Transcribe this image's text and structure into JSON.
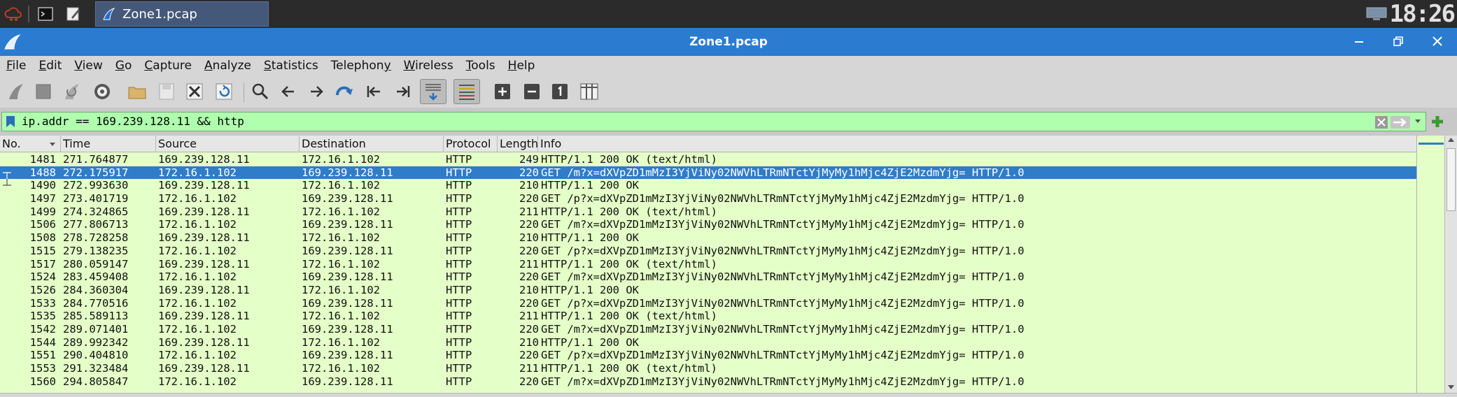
{
  "taskbar": {
    "window_title": "Zone1.pcap",
    "clock": "18:26"
  },
  "window": {
    "title": "Zone1.pcap",
    "controls": [
      "minimize-icon",
      "restore-icon",
      "close-icon"
    ]
  },
  "menu": [
    {
      "label": "File",
      "accel": "F"
    },
    {
      "label": "Edit",
      "accel": "E"
    },
    {
      "label": "View",
      "accel": "V"
    },
    {
      "label": "Go",
      "accel": "G"
    },
    {
      "label": "Capture",
      "accel": "C"
    },
    {
      "label": "Analyze",
      "accel": "A"
    },
    {
      "label": "Statistics",
      "accel": "S"
    },
    {
      "label": "Telephony",
      "accel": "y"
    },
    {
      "label": "Wireless",
      "accel": "W"
    },
    {
      "label": "Tools",
      "accel": "T"
    },
    {
      "label": "Help",
      "accel": "H"
    }
  ],
  "toolbar_icons": [
    "start-capture-icon",
    "stop-capture-icon",
    "restart-capture-icon",
    "capture-options-icon",
    "open-file-icon",
    "save-file-icon",
    "close-file-icon",
    "reload-file-icon",
    "find-packet-icon",
    "go-back-icon",
    "go-forward-icon",
    "go-to-packet-icon",
    "first-packet-icon",
    "last-packet-icon",
    "autoscroll-icon",
    "colorize-icon",
    "zoom-in-icon",
    "zoom-out-icon",
    "normal-size-icon",
    "resize-columns-icon"
  ],
  "filter": {
    "value": "ip.addr == 169.239.128.11 && http",
    "accent": "#afffaf"
  },
  "columns": {
    "no": "No.",
    "time": "Time",
    "source": "Source",
    "destination": "Destination",
    "protocol": "Protocol",
    "length": "Length",
    "info": "Info"
  },
  "colors": {
    "row_bg": "#e4ffc7",
    "selected_bg": "#2f7cc8",
    "titlebar": "#2b7bd1"
  },
  "rows": [
    {
      "no": "1481",
      "time": "271.764877",
      "src": "169.239.128.11",
      "dst": "172.16.1.102",
      "proto": "HTTP",
      "len": "249",
      "info": "HTTP/1.1 200 OK  (text/html)"
    },
    {
      "no": "1488",
      "time": "272.175917",
      "src": "172.16.1.102",
      "dst": "169.239.128.11",
      "proto": "HTTP",
      "len": "220",
      "info": "GET /m?x=dXVpZD1mMzI3YjViNy02NWVhLTRmNTctYjMyMy1hMjc4ZjE2MzdmYjg= HTTP/1.0",
      "selected": true
    },
    {
      "no": "1490",
      "time": "272.993630",
      "src": "169.239.128.11",
      "dst": "172.16.1.102",
      "proto": "HTTP",
      "len": "210",
      "info": "HTTP/1.1 200 OK"
    },
    {
      "no": "1497",
      "time": "273.401719",
      "src": "172.16.1.102",
      "dst": "169.239.128.11",
      "proto": "HTTP",
      "len": "220",
      "info": "GET /p?x=dXVpZD1mMzI3YjViNy02NWVhLTRmNTctYjMyMy1hMjc4ZjE2MzdmYjg= HTTP/1.0"
    },
    {
      "no": "1499",
      "time": "274.324865",
      "src": "169.239.128.11",
      "dst": "172.16.1.102",
      "proto": "HTTP",
      "len": "211",
      "info": "HTTP/1.1 200 OK  (text/html)"
    },
    {
      "no": "1506",
      "time": "277.806713",
      "src": "172.16.1.102",
      "dst": "169.239.128.11",
      "proto": "HTTP",
      "len": "220",
      "info": "GET /m?x=dXVpZD1mMzI3YjViNy02NWVhLTRmNTctYjMyMy1hMjc4ZjE2MzdmYjg= HTTP/1.0"
    },
    {
      "no": "1508",
      "time": "278.728258",
      "src": "169.239.128.11",
      "dst": "172.16.1.102",
      "proto": "HTTP",
      "len": "210",
      "info": "HTTP/1.1 200 OK"
    },
    {
      "no": "1515",
      "time": "279.138235",
      "src": "172.16.1.102",
      "dst": "169.239.128.11",
      "proto": "HTTP",
      "len": "220",
      "info": "GET /p?x=dXVpZD1mMzI3YjViNy02NWVhLTRmNTctYjMyMy1hMjc4ZjE2MzdmYjg= HTTP/1.0"
    },
    {
      "no": "1517",
      "time": "280.059147",
      "src": "169.239.128.11",
      "dst": "172.16.1.102",
      "proto": "HTTP",
      "len": "211",
      "info": "HTTP/1.1 200 OK  (text/html)"
    },
    {
      "no": "1524",
      "time": "283.459408",
      "src": "172.16.1.102",
      "dst": "169.239.128.11",
      "proto": "HTTP",
      "len": "220",
      "info": "GET /m?x=dXVpZD1mMzI3YjViNy02NWVhLTRmNTctYjMyMy1hMjc4ZjE2MzdmYjg= HTTP/1.0"
    },
    {
      "no": "1526",
      "time": "284.360304",
      "src": "169.239.128.11",
      "dst": "172.16.1.102",
      "proto": "HTTP",
      "len": "210",
      "info": "HTTP/1.1 200 OK"
    },
    {
      "no": "1533",
      "time": "284.770516",
      "src": "172.16.1.102",
      "dst": "169.239.128.11",
      "proto": "HTTP",
      "len": "220",
      "info": "GET /p?x=dXVpZD1mMzI3YjViNy02NWVhLTRmNTctYjMyMy1hMjc4ZjE2MzdmYjg= HTTP/1.0"
    },
    {
      "no": "1535",
      "time": "285.589113",
      "src": "169.239.128.11",
      "dst": "172.16.1.102",
      "proto": "HTTP",
      "len": "211",
      "info": "HTTP/1.1 200 OK  (text/html)"
    },
    {
      "no": "1542",
      "time": "289.071401",
      "src": "172.16.1.102",
      "dst": "169.239.128.11",
      "proto": "HTTP",
      "len": "220",
      "info": "GET /m?x=dXVpZD1mMzI3YjViNy02NWVhLTRmNTctYjMyMy1hMjc4ZjE2MzdmYjg= HTTP/1.0"
    },
    {
      "no": "1544",
      "time": "289.992342",
      "src": "169.239.128.11",
      "dst": "172.16.1.102",
      "proto": "HTTP",
      "len": "210",
      "info": "HTTP/1.1 200 OK"
    },
    {
      "no": "1551",
      "time": "290.404810",
      "src": "172.16.1.102",
      "dst": "169.239.128.11",
      "proto": "HTTP",
      "len": "220",
      "info": "GET /p?x=dXVpZD1mMzI3YjViNy02NWVhLTRmNTctYjMyMy1hMjc4ZjE2MzdmYjg= HTTP/1.0"
    },
    {
      "no": "1553",
      "time": "291.323484",
      "src": "169.239.128.11",
      "dst": "172.16.1.102",
      "proto": "HTTP",
      "len": "211",
      "info": "HTTP/1.1 200 OK  (text/html)"
    },
    {
      "no": "1560",
      "time": "294.805847",
      "src": "172.16.1.102",
      "dst": "169.239.128.11",
      "proto": "HTTP",
      "len": "220",
      "info": "GET /m?x=dXVpZD1mMzI3YjViNy02NWVhLTRmNTctYjMyMy1hMjc4ZjE2MzdmYjg= HTTP/1.0"
    }
  ]
}
